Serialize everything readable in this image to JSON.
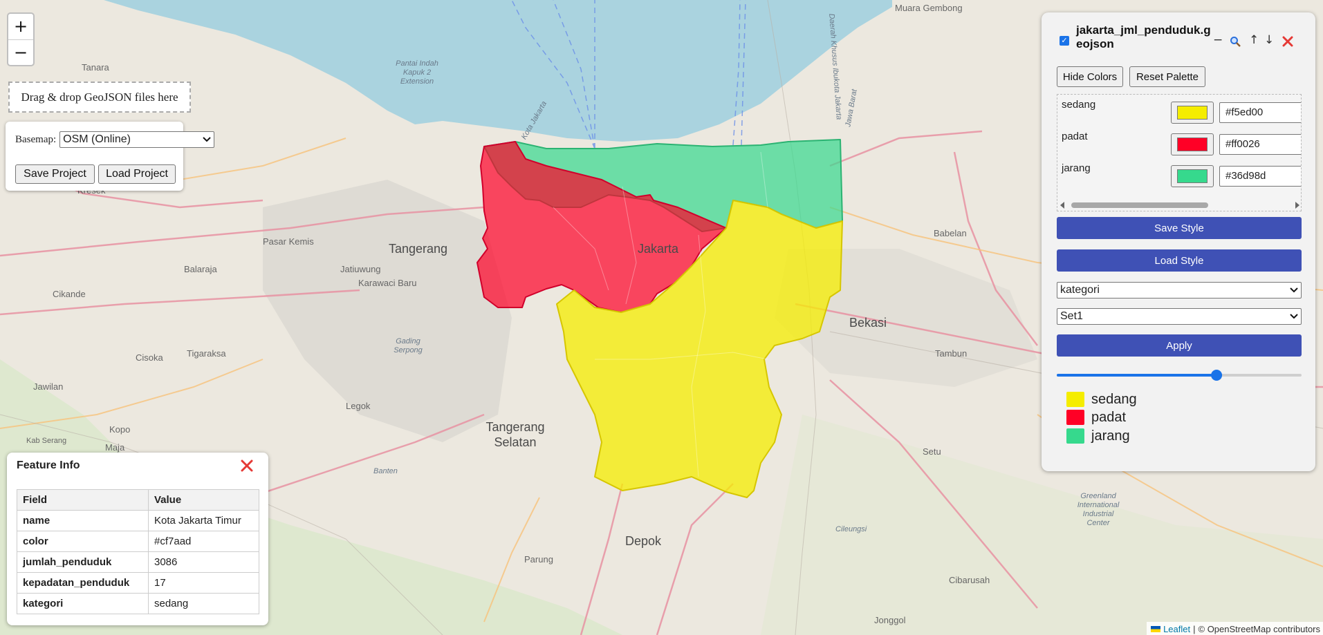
{
  "map": {
    "places": [
      {
        "name": "Muara Gembong"
      },
      {
        "name": "Tanara"
      },
      {
        "name": "Kresek"
      },
      {
        "name": "Pasar Kemis"
      },
      {
        "name": "Tangerang"
      },
      {
        "name": "Jakarta"
      },
      {
        "name": "Balaraja"
      },
      {
        "name": "Jatiuwung"
      },
      {
        "name": "Karawaci Baru"
      },
      {
        "name": "Cikande"
      },
      {
        "name": "Bekasi"
      },
      {
        "name": "Babelan"
      },
      {
        "name": "Tambun"
      },
      {
        "name": "Cisoka"
      },
      {
        "name": "Tigaraksa"
      },
      {
        "name": "Jawilan"
      },
      {
        "name": "Legok"
      },
      {
        "name": "Tangerang Selatan"
      },
      {
        "name": "Kopo"
      },
      {
        "name": "Maja"
      },
      {
        "name": "Kab Serang"
      },
      {
        "name": "Setu"
      },
      {
        "name": "Depok"
      },
      {
        "name": "Parung"
      },
      {
        "name": "Cileungsi"
      },
      {
        "name": "Cibarusah"
      },
      {
        "name": "Jonggol"
      },
      {
        "name": "Greenland International Industrial Center"
      },
      {
        "name": "Pantai Indah Kapuk 2 Extension"
      },
      {
        "name": "Gading Serpong"
      },
      {
        "name": "Banten"
      },
      {
        "name": "Jawa Barat"
      },
      {
        "name": "Daerah Khusus Ibukota Jakarta"
      },
      {
        "name": "Kota Jakarta"
      }
    ],
    "choropleth_colors": {
      "sedang": "#f5ed00",
      "padat": "#ff0026",
      "jarang": "#36d98d"
    }
  },
  "zoom": {
    "in_label": "+",
    "out_label": "−"
  },
  "left_panel": {
    "dropzone_text": "Drag & drop GeoJSON files here",
    "basemap_label": "Basemap:",
    "basemap_value": "OSM (Online)",
    "save_project": "Save Project",
    "load_project": "Load Project"
  },
  "layer_panel": {
    "title": "jakarta_jml_penduduk.geojson",
    "checked": true,
    "icons": [
      "minus-icon",
      "search-icon",
      "arrow-up-icon",
      "arrow-down-icon",
      "close-icon"
    ],
    "hide_colors": "Hide Colors",
    "reset_palette": "Reset Palette",
    "palette": [
      {
        "name": "sedang",
        "hex": "#f5ed00"
      },
      {
        "name": "padat",
        "hex": "#ff0026"
      },
      {
        "name": "jarang",
        "hex": "#36d98d"
      }
    ],
    "save_style": "Save Style",
    "load_style": "Load Style",
    "field_select": "kategori",
    "palette_select": "Set1",
    "apply": "Apply",
    "opacity": 0.66,
    "legend": [
      {
        "label": "sedang",
        "color": "#f5ed00"
      },
      {
        "label": "padat",
        "color": "#ff0026"
      },
      {
        "label": "jarang",
        "color": "#36d98d"
      }
    ]
  },
  "feature_info": {
    "title": "Feature Info",
    "headers": [
      "Field",
      "Value"
    ],
    "rows": [
      {
        "field": "name",
        "value": "Kota Jakarta Timur"
      },
      {
        "field": "color",
        "value": "#cf7aad"
      },
      {
        "field": "jumlah_penduduk",
        "value": "3086"
      },
      {
        "field": "kepadatan_penduduk",
        "value": "17"
      },
      {
        "field": "kategori",
        "value": "sedang"
      }
    ]
  },
  "attribution": {
    "leaflet": "Leaflet",
    "separator": "|",
    "text": "© OpenStreetMap contributors"
  }
}
